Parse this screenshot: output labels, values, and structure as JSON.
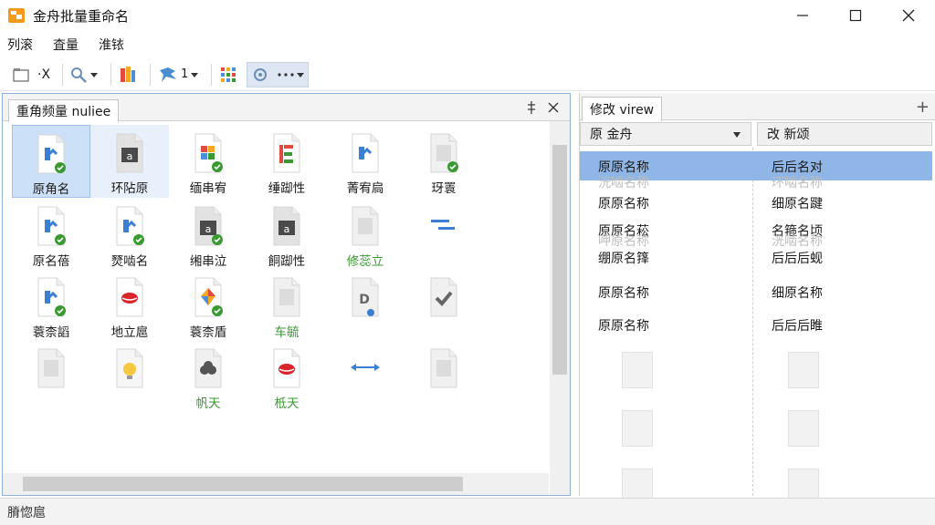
{
  "window": {
    "title": "金舟批量重命名"
  },
  "menu": {
    "items": [
      "列滚",
      "査量",
      "淮铱"
    ]
  },
  "toolbar": {
    "x_label": "·X",
    "count_label": "1"
  },
  "left_panel": {
    "tab_label": "重角频量 nuliee",
    "items": [
      {
        "label": "原角名",
        "icon": "file-icon-blue-check",
        "green": false
      },
      {
        "label": "环阽原",
        "icon": "file-icon-dark",
        "green": false
      },
      {
        "label": "缅串宥",
        "icon": "file-icon-office-check",
        "green": false
      },
      {
        "label": "缍踋性",
        "icon": "file-icon-red-green",
        "green": false
      },
      {
        "label": "菁宥扃",
        "icon": "file-icon-blue",
        "green": false
      },
      {
        "label": "玡瞏",
        "icon": "file-icon-gray-check",
        "green": false
      },
      {
        "label": "原名蓓",
        "icon": "file-icon-blue-check",
        "green": false
      },
      {
        "label": "燹啮名",
        "icon": "file-icon-blue-check",
        "green": false
      },
      {
        "label": "缃串泣",
        "icon": "file-icon-dark-check",
        "green": false
      },
      {
        "label": "餇踋性",
        "icon": "file-icon-dark",
        "green": false
      },
      {
        "label": "修蕊立",
        "icon": "file-icon-gray",
        "green": true
      },
      {
        "label": "",
        "icon": "file-icon-lines",
        "green": false
      },
      {
        "label": "蓑柰謟",
        "icon": "file-icon-blue-check",
        "green": false
      },
      {
        "label": "地立扈",
        "icon": "file-icon-red-lips",
        "green": false
      },
      {
        "label": "蓑柰盾",
        "icon": "file-icon-colorful-check",
        "green": false
      },
      {
        "label": "车毓",
        "icon": "file-icon-gray",
        "green": true
      },
      {
        "label": "",
        "icon": "file-icon-gray-d",
        "green": false
      },
      {
        "label": "",
        "icon": "file-icon-gray-check-mark",
        "green": false
      },
      {
        "label": "",
        "icon": "file-icon-gray",
        "green": false
      },
      {
        "label": "",
        "icon": "file-icon-bulb",
        "green": false
      },
      {
        "label": "帆天",
        "icon": "file-icon-dark-grape",
        "green": true
      },
      {
        "label": "柢天",
        "icon": "file-icon-red-lips",
        "green": true
      },
      {
        "label": "",
        "icon": "file-icon-arrows",
        "green": false
      },
      {
        "label": "",
        "icon": "file-icon-gray",
        "green": false
      }
    ]
  },
  "right_panel": {
    "tab_label": "修改 virew",
    "col1_header": "原 金舟",
    "col2_header": "改 新颂",
    "rows": [
      {
        "original": "原原名称",
        "renamed": "后后名对"
      },
      {
        "original": "原原名称",
        "renamed": "细原名踺"
      },
      {
        "original": "原原名菘",
        "renamed": "名箍名顷"
      },
      {
        "original": "绷原名箨",
        "renamed": "后后后蚬"
      },
      {
        "original": "原原名称",
        "renamed": "细原名称"
      },
      {
        "original": "原原名称",
        "renamed": "后后后睢"
      }
    ],
    "ghost_rows": [
      {
        "original": "洸啮名称",
        "renamed": "环啮名称"
      },
      {
        "original": "呷原名称",
        "renamed": "洸啮名称"
      }
    ]
  },
  "status": {
    "text": "膌惚扈"
  },
  "colors": {
    "accent": "#8fb6e6",
    "selected_cell": "#cce0f7",
    "check_green": "#3a9a32",
    "panel_border": "#8fb0d6"
  }
}
